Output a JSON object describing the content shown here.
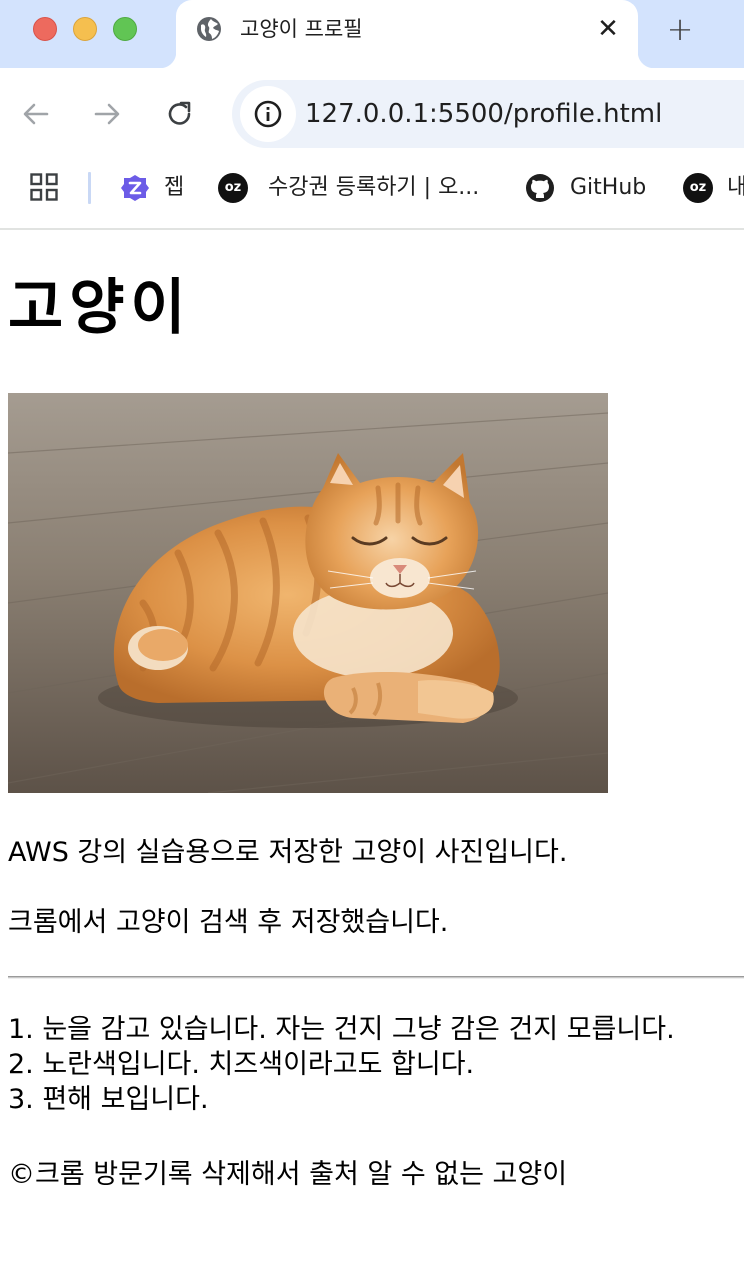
{
  "window": {
    "controls": [
      "close-button",
      "minimize-button",
      "zoom-button"
    ]
  },
  "tab": {
    "title": "고양이 프로필",
    "close_glyph": "✕",
    "favicon": "globe-icon"
  },
  "new_tab_glyph": "+",
  "toolbar": {
    "url": "127.0.0.1:5500/profile.html",
    "icons": [
      "back-arrow-icon",
      "forward-arrow-icon",
      "reload-icon",
      "info-icon"
    ]
  },
  "bookmarks": {
    "items": [
      {
        "label": "젭",
        "icon": "zep-icon"
      },
      {
        "label": "수강권 등록하기 | 오...",
        "icon": "oz-icon",
        "icon_text": "oz"
      },
      {
        "label": "GitHub",
        "icon": "github-icon"
      },
      {
        "label": "내",
        "icon": "oz-icon",
        "icon_text": "oz"
      }
    ]
  },
  "page": {
    "title": "고양이",
    "image": "orange tabby cat lying on wooden floor",
    "paragraphs": [
      "AWS 강의 실습용으로 저장한 고양이 사진입니다.",
      "크롬에서 고양이 검색 후 저장했습니다."
    ],
    "list": [
      "1. 눈을 감고 있습니다. 자는 건지 그냥 감은 건지 모릅니다.",
      "2. 노란색입니다. 치즈색이라고도 합니다.",
      "3. 편해 보입니다."
    ],
    "footer": "©크롬 방문기록 삭제해서 출처 알 수 없는 고양이"
  },
  "colors": {
    "tabstrip": "#d3e3fd",
    "omnibox": "#edf2fa",
    "traffic_red": "#ed6a5e",
    "traffic_yellow": "#f5bf4f",
    "traffic_green": "#61c554"
  }
}
